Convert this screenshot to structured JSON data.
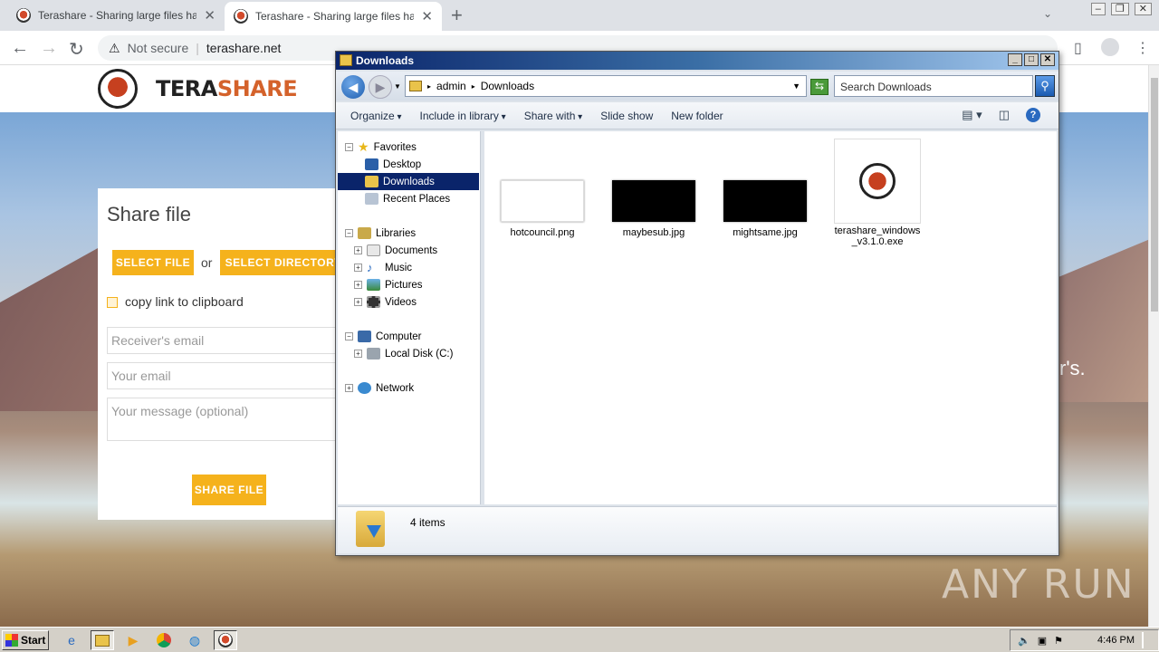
{
  "browser": {
    "tabs": [
      {
        "title": "Terashare - Sharing large files has ne"
      },
      {
        "title": "Terashare - Sharing large files has ne"
      }
    ],
    "address": {
      "security": "Not secure",
      "url": "terashare.net"
    }
  },
  "site": {
    "brand_a": "TERA",
    "brand_b": "SHARE",
    "hero_text": "r's.",
    "share": {
      "title": "Share file",
      "select_file": "SELECT FILE",
      "or": "or",
      "select_directory": "SELECT DIRECTORY",
      "copy_link": "copy link to clipboard",
      "receiver_placeholder": "Receiver's email",
      "your_email_placeholder": "Your email",
      "message_placeholder": "Your message (optional)",
      "share_button": "SHARE FILE"
    },
    "watermark": "ANY RUN"
  },
  "explorer": {
    "title": "Downloads",
    "breadcrumb": [
      "admin",
      "Downloads"
    ],
    "search_placeholder": "Search Downloads",
    "commands": [
      "Organize",
      "Include in library",
      "Share with",
      "Slide show",
      "New folder"
    ],
    "nav": {
      "favorites": "Favorites",
      "desktop": "Desktop",
      "downloads": "Downloads",
      "recent": "Recent Places",
      "libraries": "Libraries",
      "documents": "Documents",
      "music": "Music",
      "pictures": "Pictures",
      "videos": "Videos",
      "computer": "Computer",
      "localdisk": "Local Disk (C:)",
      "network": "Network"
    },
    "files": [
      {
        "name": "hotcouncil.png",
        "thumb": "white"
      },
      {
        "name": "maybesub.jpg",
        "thumb": "black"
      },
      {
        "name": "mightsame.jpg",
        "thumb": "black"
      },
      {
        "name": "terashare_windows_v3.1.0.exe",
        "thumb": "logo"
      }
    ],
    "item_count": "4 items"
  },
  "taskbar": {
    "start": "Start",
    "clock": "4:46 PM"
  }
}
